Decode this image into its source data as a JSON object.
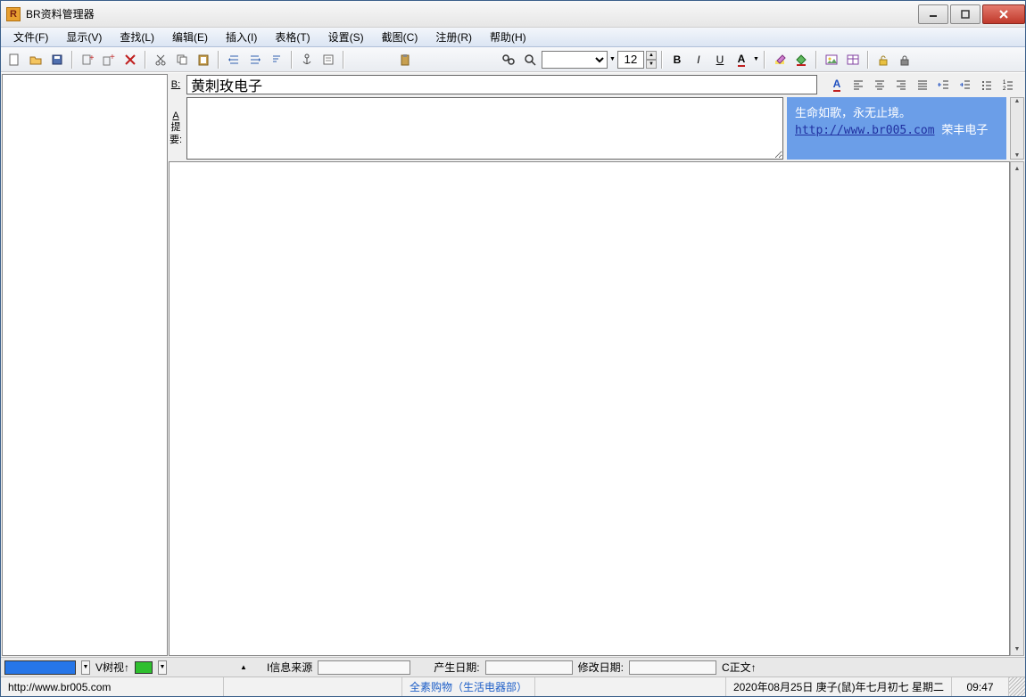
{
  "window": {
    "title": "BR资料管理器"
  },
  "menu": {
    "file": "文件(F)",
    "view": "显示(V)",
    "find": "查找(L)",
    "edit": "编辑(E)",
    "insert": "插入(I)",
    "table": "表格(T)",
    "settings": "设置(S)",
    "capture": "截图(C)",
    "register": "注册(R)",
    "help": "帮助(H)"
  },
  "toolbar": {
    "font_size": "12"
  },
  "editor": {
    "title_label": "B:",
    "title_value": "黄刺玫电子",
    "summary_label": "A提要:"
  },
  "info_panel": {
    "line1": "生命如歌，永无止境。",
    "url": "http://www.br005.com",
    "tail": "荣丰电子"
  },
  "optbar": {
    "tree_view": "V树视↑",
    "source_label": "I信息来源",
    "create_label": "产生日期:",
    "modify_label": "修改日期:",
    "body_label": "C正文↑"
  },
  "status": {
    "url": "http://www.br005.com",
    "shop": "全素购物（生活电器部）",
    "date": "2020年08月25日 庚子(鼠)年七月初七 星期二",
    "time": "09:47"
  }
}
